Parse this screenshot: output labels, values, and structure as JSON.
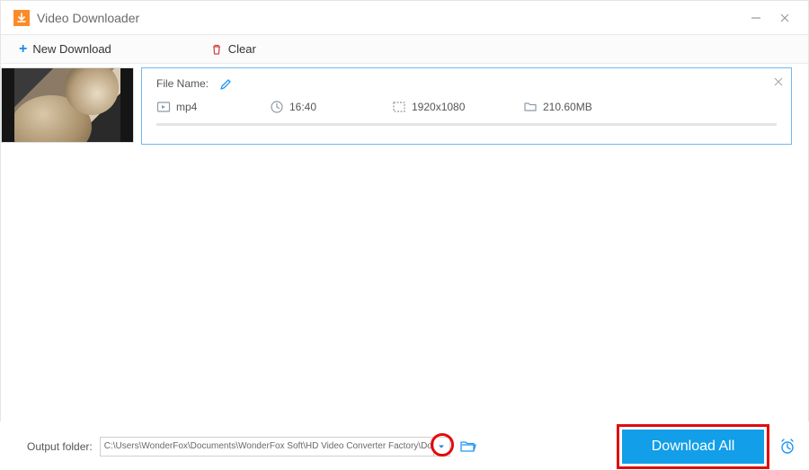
{
  "window": {
    "title": "Video Downloader"
  },
  "toolbar": {
    "new_download_label": "New Download",
    "clear_label": "Clear"
  },
  "item": {
    "file_name_label": "File Name:",
    "format": "mp4",
    "duration": "16:40",
    "resolution": "1920x1080",
    "size": "210.60MB"
  },
  "output": {
    "label": "Output folder:",
    "path": "C:\\Users\\WonderFox\\Documents\\WonderFox Soft\\HD Video Converter Factory\\Download_Video\\"
  },
  "actions": {
    "download_all": "Download All"
  }
}
